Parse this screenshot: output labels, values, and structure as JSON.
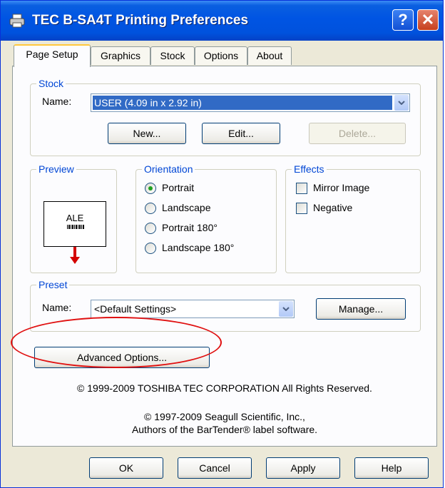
{
  "window": {
    "title": "TEC B-SA4T Printing Preferences",
    "help_glyph": "?",
    "close_glyph": "✕"
  },
  "tabs": [
    "Page Setup",
    "Graphics",
    "Stock",
    "Options",
    "About"
  ],
  "stock": {
    "legend": "Stock",
    "name_label": "Name:",
    "name_value": "USER (4.09 in x 2.92 in)",
    "new_label": "New...",
    "edit_label": "Edit...",
    "delete_label": "Delete..."
  },
  "preview": {
    "legend": "Preview",
    "label_text": "ALE"
  },
  "orientation": {
    "legend": "Orientation",
    "options": [
      "Portrait",
      "Landscape",
      "Portrait 180°",
      "Landscape 180°"
    ],
    "selected": "Portrait"
  },
  "effects": {
    "legend": "Effects",
    "options": [
      "Mirror Image",
      "Negative"
    ]
  },
  "preset": {
    "legend": "Preset",
    "name_label": "Name:",
    "name_value": "<Default Settings>",
    "manage_label": "Manage..."
  },
  "advanced_label": "Advanced Options...",
  "copyright": {
    "line1": "© 1999-2009 TOSHIBA TEC CORPORATION All Rights Reserved.",
    "line2": "© 1997-2009 Seagull Scientific, Inc.,",
    "line3": "Authors of the BarTender® label software."
  },
  "footer": {
    "ok": "OK",
    "cancel": "Cancel",
    "apply": "Apply",
    "help": "Help"
  },
  "colors": {
    "title_bar": "#0054E3",
    "dialog_bg": "#ECE9D8",
    "accent_label": "#0046D5",
    "highlight_oval": "#E01010",
    "selection": "#316AC5"
  },
  "icons": {
    "title": "printer-icon",
    "dropdown": "chevron-down-icon",
    "preview_arrow": "arrow-down-icon"
  }
}
